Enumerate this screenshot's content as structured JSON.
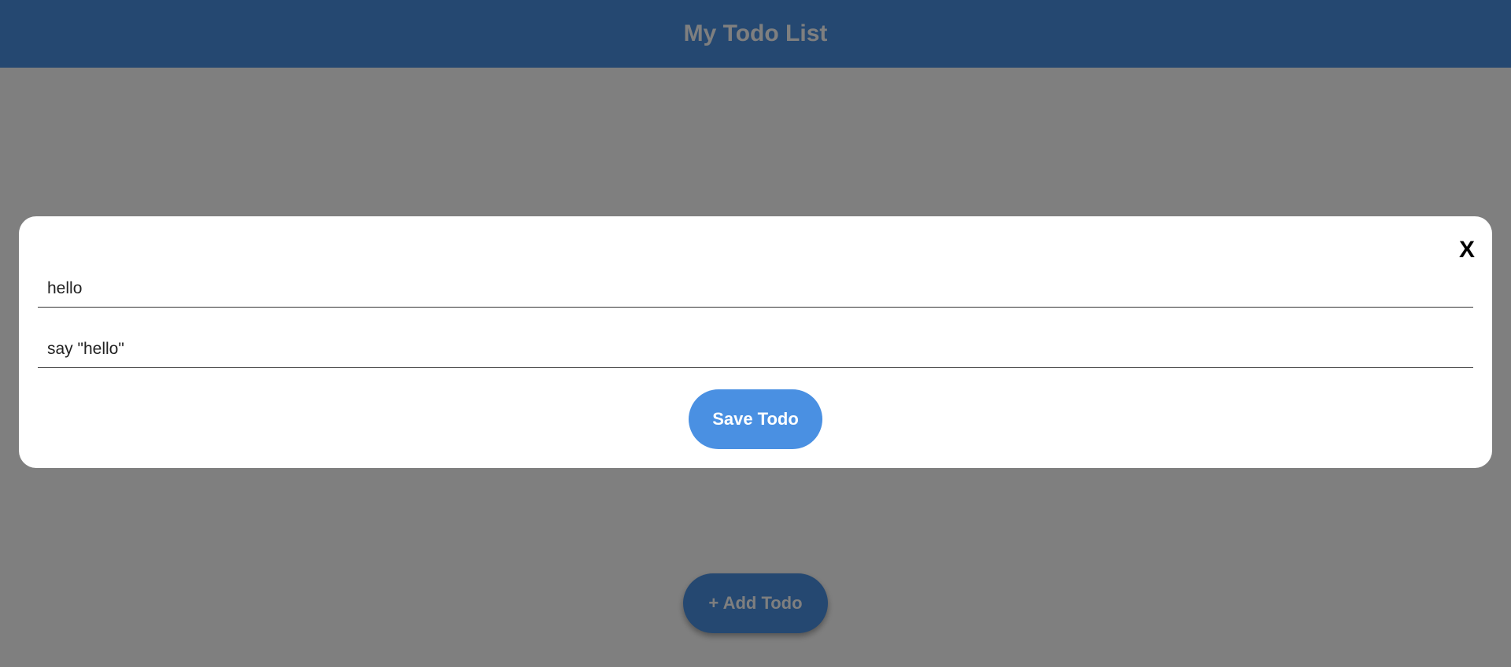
{
  "header": {
    "title": "My Todo List"
  },
  "main": {
    "add_button_label": "+ Add Todo"
  },
  "modal": {
    "close_label": "X",
    "title_field_value": "hello",
    "description_field_value": "say \"hello\"",
    "save_button_label": "Save Todo"
  },
  "colors": {
    "accent": "#4a90e2",
    "overlay": "rgba(0,0,0,0.5)",
    "modal_background": "#ffffff"
  }
}
